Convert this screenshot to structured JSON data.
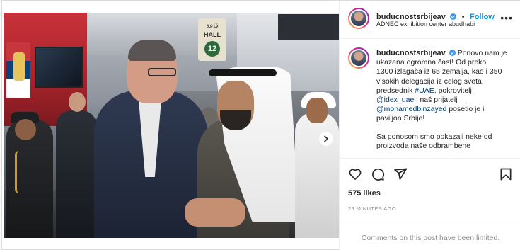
{
  "post": {
    "username": "buducnostsrbijeav",
    "follow_label": "Follow",
    "separator": "•",
    "location": "ADNEC exhibition center abudhabi",
    "more_label": "•••",
    "caption": {
      "username": "buducnostsrbijeav",
      "paragraph1_lines": [
        "Ponovo nam je",
        "ukazana ogromna čast! Od preko",
        "1300 izlagača iz 65 zemalja, kao i 350",
        "visokih delegacija iz celog sveta,",
        "predsednik",
        "pokrovitelj",
        "i naš prijatelj",
        "posetio je i",
        "paviljon Srbije!"
      ],
      "hashtag_uae": "#UAE",
      "mention_idex": "@idex_uae",
      "mention_mbz": "@mohamedbinzayed",
      "paragraph2_lines": [
        "Sa ponosom smo pokazali neke od",
        "proizvoda naše odbrambene"
      ]
    },
    "likes": "575 likes",
    "time": "23 MINUTES AGO",
    "comments_limited": "Comments on this post have been limited."
  },
  "media": {
    "hall_sign_arabic": "قاعة",
    "hall_sign_text": "HALL",
    "hall_sign_number": "12",
    "carousel_dots": 5,
    "active_dot": 0
  },
  "colors": {
    "link": "#00376b",
    "follow": "#0095f6",
    "verified": "#3897f0",
    "muted": "#8e8e8e"
  },
  "icons": [
    "verified-badge-icon",
    "more-options-icon",
    "heart-icon",
    "comment-icon",
    "share-icon",
    "bookmark-icon",
    "chevron-right-icon"
  ]
}
